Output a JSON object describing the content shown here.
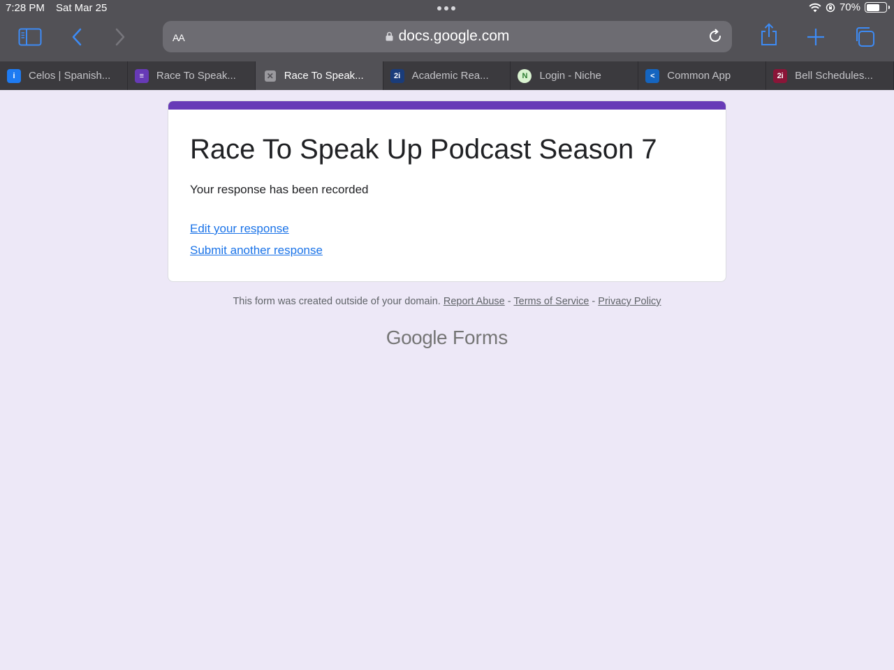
{
  "status_bar": {
    "time": "7:28 PM",
    "date": "Sat Mar 25",
    "battery": "70%",
    "battery_level": 0.7
  },
  "toolbar": {
    "text_size_label": "AA",
    "url": "docs.google.com"
  },
  "tabs": [
    {
      "label": "Celos | Spanish...",
      "icon": "celos-icon",
      "color": "#1e7bf2",
      "glyph": "i"
    },
    {
      "label": "Race To Speak...",
      "icon": "google-forms-icon",
      "color": "#673ab7",
      "glyph": "≡"
    },
    {
      "label": "Race To Speak...",
      "icon": "close-tab-icon",
      "active": true
    },
    {
      "label": "Academic Rea...",
      "icon": "2i-icon",
      "color": "#1a3c7a",
      "glyph": "2i"
    },
    {
      "label": "Login - Niche",
      "icon": "niche-icon",
      "color": "#d9f2d0",
      "glyph": "N"
    },
    {
      "label": "Common App",
      "icon": "common-app-icon",
      "color": "#1565c0",
      "glyph": "<"
    },
    {
      "label": "Bell Schedules...",
      "icon": "bell-schedules-icon",
      "color": "#8a1538",
      "glyph": "2i"
    }
  ],
  "form": {
    "title": "Race To Speak Up Podcast Season 7",
    "message": "Your response has been recorded",
    "edit_link": "Edit your response",
    "another_link": "Submit another response",
    "accent_color": "#673ab7"
  },
  "footer": {
    "text": "This form was created outside of your domain.",
    "report_abuse": "Report Abuse",
    "sep1": "-",
    "terms": "Terms of Service",
    "sep2": "-",
    "privacy": "Privacy Policy"
  },
  "brand": {
    "google": "Google",
    "forms": "Forms"
  }
}
